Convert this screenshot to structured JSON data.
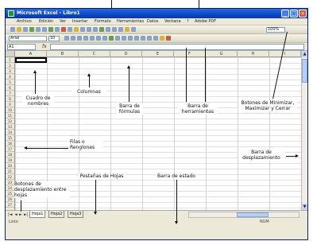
{
  "window": {
    "title": "Microsoft Excel - Libro1",
    "min_label": "_",
    "max_label": "□",
    "close_label": "×"
  },
  "menu": [
    "Archivo",
    "Edición",
    "Ver",
    "Insertar",
    "Formato",
    "Herramientas",
    "Datos",
    "Ventana",
    "?",
    "Adobe PDF"
  ],
  "toolbar": {
    "font_name": "Arial",
    "font_size": "10",
    "zoom": "100%"
  },
  "formula_bar": {
    "namebox": "A1",
    "fx": "fx"
  },
  "columns": [
    "A",
    "B",
    "C",
    "D",
    "E",
    "F",
    "G",
    "H",
    "I"
  ],
  "rows": [
    "1",
    "2",
    "3",
    "4",
    "5",
    "6",
    "7",
    "8",
    "9",
    "10",
    "11",
    "12",
    "13",
    "14",
    "15",
    "16",
    "17",
    "18",
    "19",
    "20",
    "21",
    "22",
    "23",
    "24",
    "25",
    "26",
    "27"
  ],
  "sheet_tabs": [
    "Hoja1",
    "Hoja2",
    "Hoja3"
  ],
  "status": {
    "left": "Listo",
    "right": "NUM"
  },
  "annotations": {
    "cuadro_nombres": "Cuadro de nombres",
    "columnas": "Columnas",
    "barra_formulas": "Barra de fórmulas",
    "barra_herramientas": "Barra de herramientas",
    "botones_ventana": "Botones de Minimizar, Maximizar y Cerrar",
    "filas": "Filas o Renglones",
    "barra_desplazamiento": "Barra de desplazamiento",
    "botones_desplazamiento": "Botones de desplazamiento entre hojas",
    "pestanas": "Pestañas de Hojas",
    "barra_estado": "Barra de estado"
  }
}
